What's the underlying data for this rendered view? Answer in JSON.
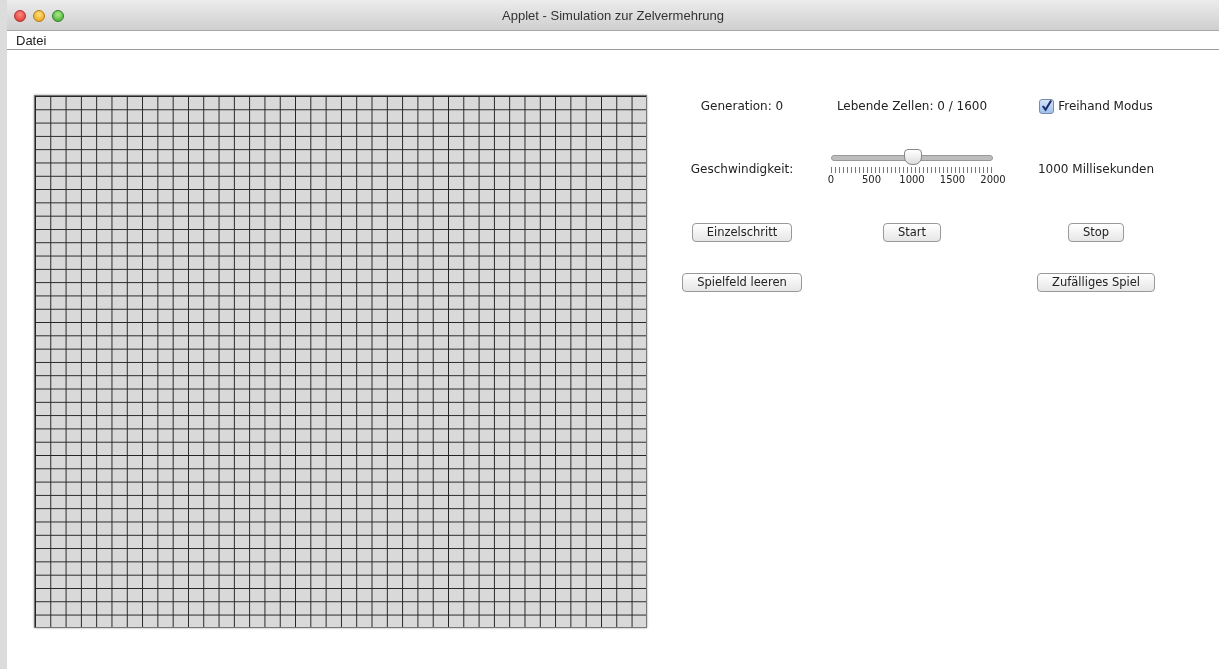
{
  "window": {
    "title": "Applet - Simulation zur Zelvermehrung"
  },
  "menu": [
    "Datei"
  ],
  "stats": {
    "generation": "Generation: 0",
    "living_cells": "Lebende Zellen: 0 / 1600"
  },
  "freehand": {
    "label": "Freihand Modus",
    "checked": true
  },
  "speed": {
    "label": "Geschwindigkeit:",
    "level": 0.5,
    "tick_labels": [
      "0",
      "500",
      "1000",
      "1500",
      "2000"
    ],
    "reading": "1000 Millisekunden"
  },
  "buttons": [
    {
      "label": "Einzelschritt"
    },
    {
      "label": "Start"
    },
    {
      "label": "Stop"
    },
    {
      "label": "Spielfeld leeren"
    },
    {
      "label": "Zufälliges Spiel"
    }
  ]
}
